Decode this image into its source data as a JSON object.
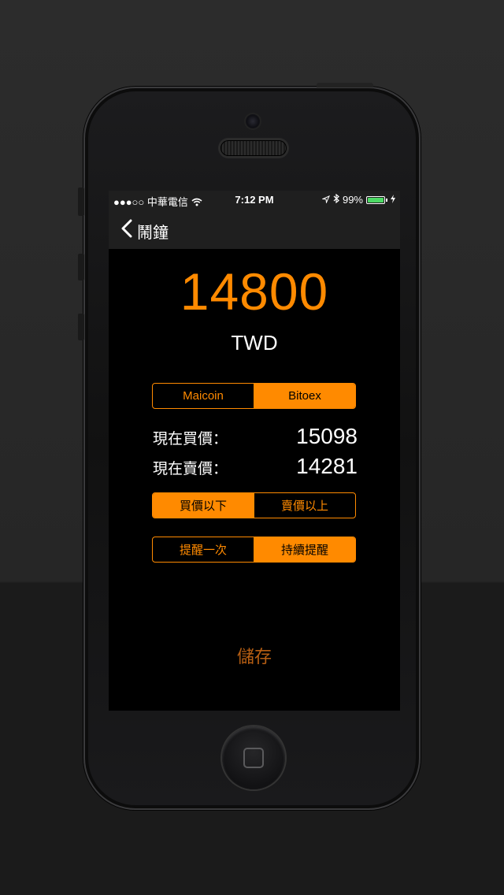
{
  "status_bar": {
    "signal": "●●●○○",
    "carrier": "中華電信",
    "time": "7:12 PM",
    "battery_percent": "99%",
    "battery_level": 0.99
  },
  "nav": {
    "back_label": "鬧鐘"
  },
  "price": {
    "value": "14800",
    "currency": "TWD"
  },
  "exchange": {
    "options": [
      "Maicoin",
      "Bitoex"
    ],
    "selected": "Bitoex"
  },
  "rates": {
    "buy_label": "現在買價：",
    "buy_value": "15098",
    "sell_label": "現在賣價：",
    "sell_value": "14281"
  },
  "condition": {
    "options": [
      "買價以下",
      "賣價以上"
    ],
    "selected": "買價以下"
  },
  "repeat": {
    "options": [
      "提醒一次",
      "持續提醒"
    ],
    "selected": "持續提醒"
  },
  "save_label": "儲存",
  "colors": {
    "accent": "#ff8a00",
    "save_text": "#b85f13",
    "background": "#000000",
    "bar": "#1f1f1f"
  },
  "icons": [
    "wifi-icon",
    "location-arrow-icon",
    "bluetooth-icon",
    "battery-icon",
    "charging-icon",
    "back-chevron-icon"
  ]
}
